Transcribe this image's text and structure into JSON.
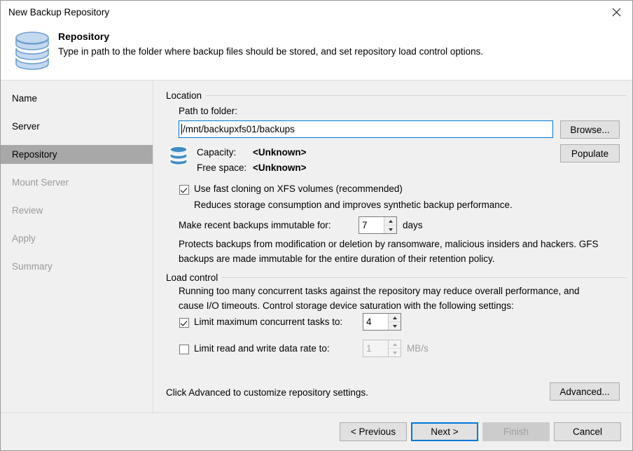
{
  "window": {
    "title": "New Backup Repository",
    "close_icon": "close-icon"
  },
  "header": {
    "icon": "repository-database-icon",
    "title": "Repository",
    "description": "Type in path to the folder where backup files should be stored, and set repository load control options."
  },
  "sidebar": {
    "items": [
      {
        "label": "Name",
        "state": "visited"
      },
      {
        "label": "Server",
        "state": "visited"
      },
      {
        "label": "Repository",
        "state": "active"
      },
      {
        "label": "Mount Server",
        "state": "pending"
      },
      {
        "label": "Review",
        "state": "pending"
      },
      {
        "label": "Apply",
        "state": "pending"
      },
      {
        "label": "Summary",
        "state": "pending"
      }
    ]
  },
  "location": {
    "group_label": "Location",
    "path_label": "Path to folder:",
    "path_value": "/mnt/backupxfs01/backups",
    "browse_button": "Browse...",
    "populate_button": "Populate",
    "storage_icon": "database-icon",
    "capacity_label": "Capacity:",
    "capacity_value": "<Unknown>",
    "free_space_label": "Free space:",
    "free_space_value": "<Unknown>",
    "fast_clone_label": "Use fast cloning on XFS volumes (recommended)",
    "fast_clone_checked": true,
    "fast_clone_hint": "Reduces storage consumption and improves synthetic backup performance.",
    "immutable_label": "Make recent backups immutable for:",
    "immutable_value": "7",
    "immutable_units": "days",
    "immutable_hint_line1": "Protects backups from modification or deletion by ransomware, malicious insiders and hackers. GFS",
    "immutable_hint_line2": "backups are made immutable for the entire duration of their retention policy."
  },
  "load_control": {
    "group_label": "Load control",
    "hint_line1": "Running too many concurrent tasks against the repository may reduce overall performance, and",
    "hint_line2": "cause I/O timeouts. Control storage device saturation with the following settings:",
    "limit_tasks_label": "Limit maximum concurrent tasks to:",
    "limit_tasks_checked": true,
    "limit_tasks_value": "4",
    "limit_rate_label": "Limit read and write data rate to:",
    "limit_rate_checked": false,
    "limit_rate_value": "1",
    "limit_rate_units": "MB/s"
  },
  "advanced": {
    "hint": "Click Advanced to customize repository settings.",
    "button": "Advanced..."
  },
  "footer": {
    "previous": "< Previous",
    "next": "Next >",
    "finish": "Finish",
    "cancel": "Cancel"
  },
  "colors": {
    "accent": "#0078d7",
    "window_bg": "#f0f0f0",
    "active_nav": "#a8a8a8",
    "icon_blue": "#3f8dc4",
    "icon_light_blue": "#bcd6ee"
  }
}
